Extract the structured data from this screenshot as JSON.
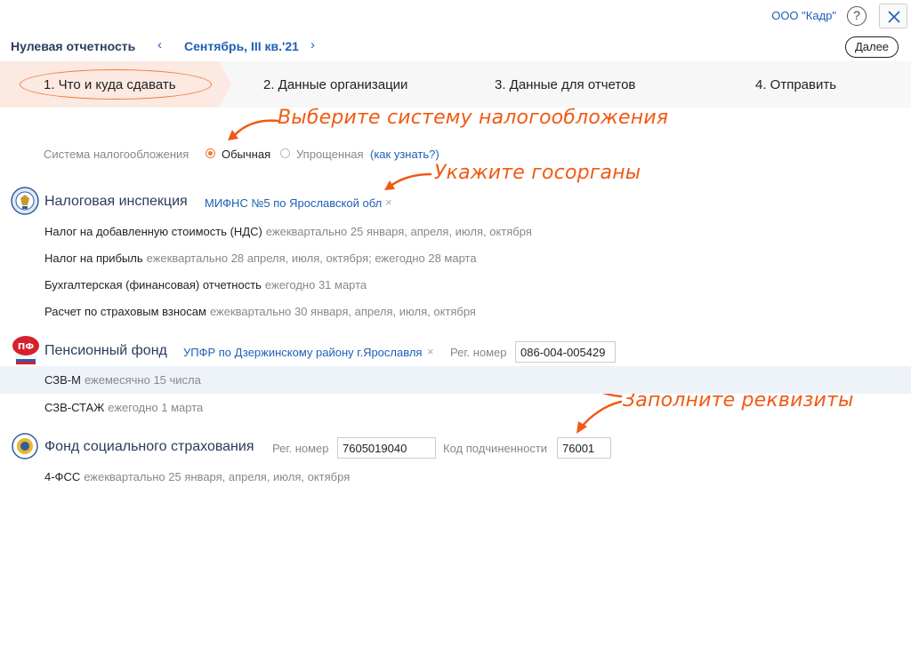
{
  "header": {
    "org_name": "ООО \"Кадр\"",
    "help": "?",
    "title": "Нулевая отчетность",
    "nav_prev": "‹",
    "period": "Сентябрь, III кв.'21",
    "nav_next": "›",
    "next_button": "Далее"
  },
  "steps": [
    {
      "label": "1. Что и куда сдавать",
      "active": true
    },
    {
      "label": "2. Данные организации"
    },
    {
      "label": "3. Данные для отчетов"
    },
    {
      "label": "4. Отправить"
    }
  ],
  "annotations": {
    "tax_system_hint": "Выберите систему налогообложения",
    "agencies_hint": "Укажите госорганы",
    "details_hint": "Заполните реквизиты"
  },
  "tax_system": {
    "label": "Система налогообложения",
    "option_regular": "Обычная",
    "option_simplified": "Упрощенная",
    "how_to_know": "(как узнать?)",
    "selected": "Обычная"
  },
  "tax_inspection": {
    "title": "Налоговая инспекция",
    "agency": "МИФНС №5 по Ярославской обл",
    "remove": "×",
    "reports": [
      {
        "name": "Налог на добавленную стоимость (НДС)",
        "due": "ежеквартально 25 января, апреля, июля, октября"
      },
      {
        "name": "Налог на прибыль",
        "due": "ежеквартально 28 апреля, июля, октября; ежегодно 28 марта"
      },
      {
        "name": "Бухгалтерская (финансовая) отчетность",
        "due": "ежегодно 31 марта"
      },
      {
        "name": "Расчет по страховым взносам",
        "due": "ежеквартально 30 января, апреля, июля, октября"
      }
    ]
  },
  "pension_fund": {
    "title": "Пенсионный фонд",
    "agency": "УПФР по Дзержинскому району г.Ярославля",
    "remove": "×",
    "reg_label": "Рег. номер",
    "reg_number": "086-004-005429",
    "logo_text": "ПФ",
    "reports": [
      {
        "name": "СЗВ-М",
        "due": "ежемесячно 15 числа"
      },
      {
        "name": "СЗВ-СТАЖ",
        "due": "ежегодно 1 марта"
      }
    ]
  },
  "social_fund": {
    "title": "Фонд социального страхования",
    "reg_label": "Рег. номер",
    "reg_number": "7605019040",
    "sub_label": "Код подчиненности",
    "sub_code": "76001",
    "reports": [
      {
        "name": "4-ФСС",
        "due": "ежеквартально 25 января, апреля, июля, октября"
      }
    ]
  },
  "colors": {
    "accent": "#f05a14",
    "link": "#1f5fb5",
    "title": "#2a3d5c"
  }
}
